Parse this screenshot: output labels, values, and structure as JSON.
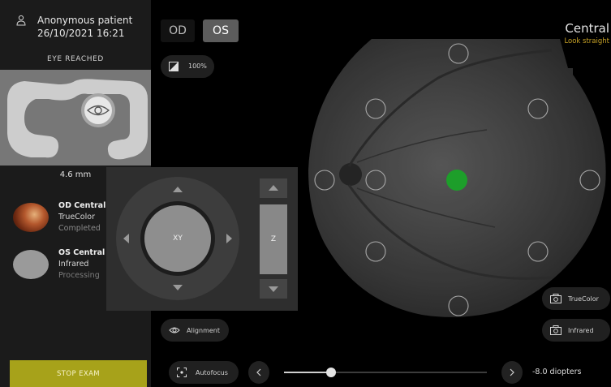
{
  "patient": {
    "name": "Anonymous patient",
    "datetime": "26/10/2021 16:21"
  },
  "status": "EYE REACHED",
  "distance": "4.6 mm",
  "scans": [
    {
      "eye_label": "OD Central",
      "type": "TrueColor",
      "status": "Completed"
    },
    {
      "eye_label": "OS Central",
      "type": "Infrared",
      "status": "Processing"
    }
  ],
  "stop_button": "STOP EXAM",
  "eye_buttons": {
    "od": "OD",
    "os": "OS",
    "selected": "OS"
  },
  "zoom": "100%",
  "joystick": {
    "xy_label": "XY",
    "z_label": "Z"
  },
  "alignment_label": "Alignment",
  "autofocus_label": "Autofocus",
  "focus": {
    "value_fraction": 0.23,
    "readout": "-8.0 diopters"
  },
  "capture": {
    "truecolor": "TrueColor",
    "infrared": "Infrared"
  },
  "fixation": {
    "title": "Central",
    "hint": "Look straight"
  },
  "colors": {
    "accent_yellow": "#a7a21a",
    "fixation_green": "#1d9e2a",
    "hint_gold": "#c9a326"
  },
  "icons": [
    "user-icon",
    "contrast-icon",
    "eye-icon",
    "focus-icon",
    "camera-icon",
    "chevron-left-icon",
    "chevron-right-icon"
  ]
}
